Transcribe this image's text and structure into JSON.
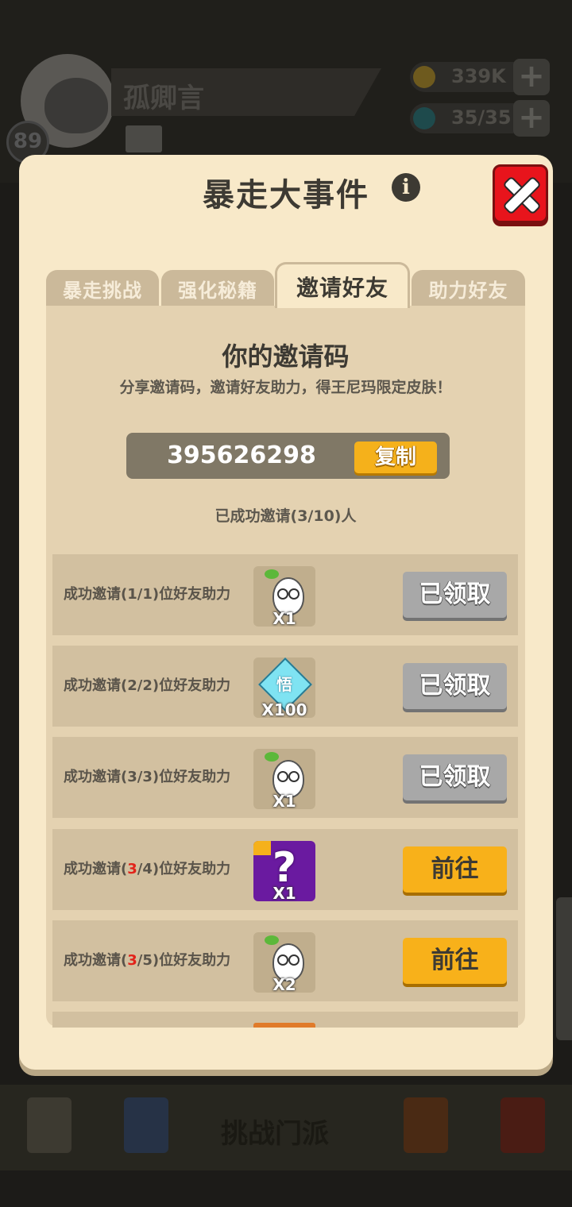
{
  "background": {
    "username": "孤卿言",
    "level": "89",
    "coins": "339K",
    "energy": "35/35",
    "bottom_nav_center_label": "挑战门派"
  },
  "modal": {
    "title": "暴走大事件",
    "tabs": [
      "暴走挑战",
      "强化秘籍",
      "邀请好友",
      "助力好友"
    ],
    "active_tab": "邀请好友",
    "code_title": "你的邀请码",
    "code_description": "分享邀请码，邀请好友助力，得王尼玛限定皮肤！",
    "invite_code": "395626298",
    "copy_label": "复制",
    "invited_count_text": "已成功邀请(3/10)人",
    "rows": [
      {
        "prefix": "成功邀请(",
        "current": "1",
        "total": "1",
        "suffix": ")位好友助力",
        "current_highlight": false,
        "reward": "radish",
        "qty": "X1",
        "button": "已领取",
        "button_state": "claimed"
      },
      {
        "prefix": "成功邀请(",
        "current": "2",
        "total": "2",
        "suffix": ")位好友助力",
        "current_highlight": false,
        "reward": "diamond",
        "reward_text": "悟",
        "qty": "X100",
        "button": "已领取",
        "button_state": "claimed"
      },
      {
        "prefix": "成功邀请(",
        "current": "3",
        "total": "3",
        "suffix": ")位好友助力",
        "current_highlight": false,
        "reward": "radish",
        "qty": "X1",
        "button": "已领取",
        "button_state": "claimed"
      },
      {
        "prefix": "成功邀请(",
        "current": "3",
        "total": "4",
        "suffix": ")位好友助力",
        "current_highlight": true,
        "reward": "mystery",
        "qty": "X1",
        "button": "前往",
        "button_state": "go"
      },
      {
        "prefix": "成功邀请(",
        "current": "3",
        "total": "5",
        "suffix": ")位好友助力",
        "current_highlight": true,
        "reward": "radish",
        "qty": "X2",
        "button": "前往",
        "button_state": "go"
      }
    ]
  }
}
